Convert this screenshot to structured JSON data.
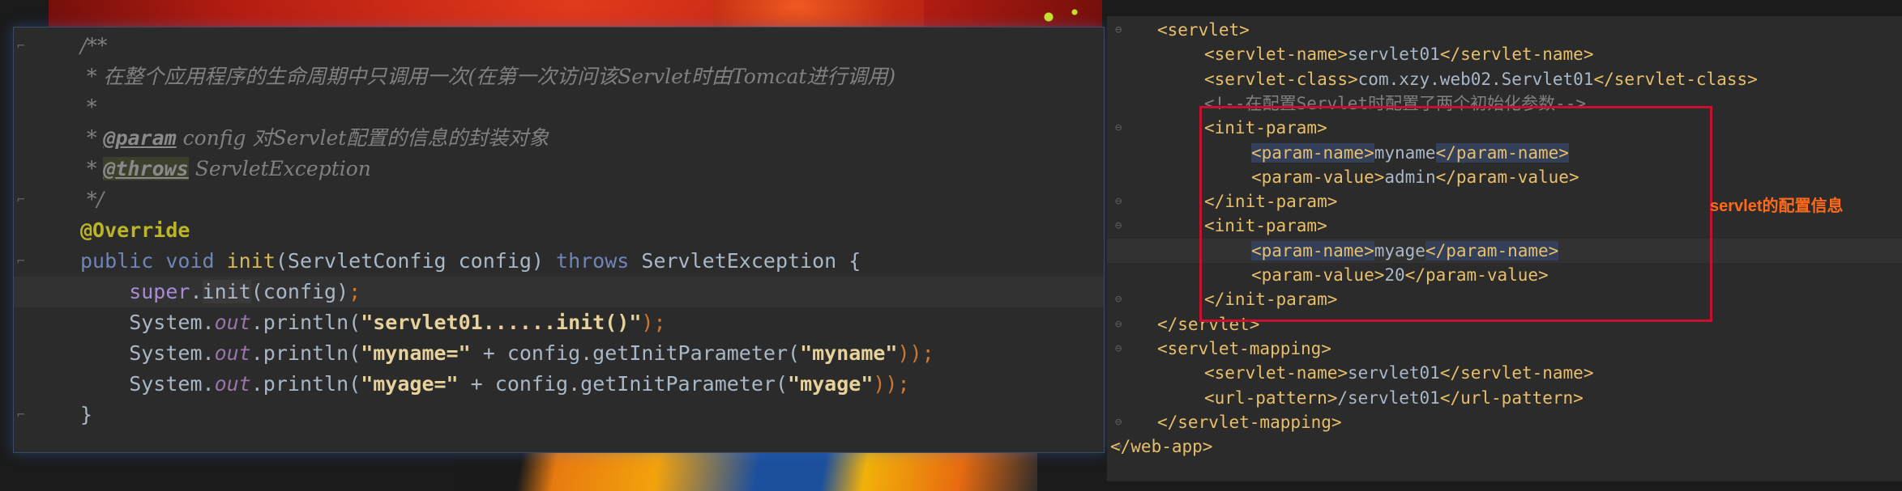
{
  "java_editor": {
    "lines": [
      {
        "parts": [
          {
            "t": "/**",
            "c": "c-comment"
          }
        ]
      },
      {
        "parts": [
          {
            "t": " * 在整个应用程序的生命周期中只调用一次(在第一次访问该Servlet时由Tomcat进行调用)",
            "c": "c-comment"
          }
        ]
      },
      {
        "parts": [
          {
            "t": " *",
            "c": "c-comment"
          }
        ]
      },
      {
        "parts": [
          {
            "t": " * ",
            "c": "c-comment"
          },
          {
            "t": "@param",
            "c": "c-doctag"
          },
          {
            "t": " config",
            "c": "c-comment"
          },
          {
            "t": " 对Servlet配置的信息的封装对象",
            "c": "c-comment"
          }
        ]
      },
      {
        "parts": [
          {
            "t": " * ",
            "c": "c-comment"
          },
          {
            "t": "@throws",
            "c": "c-doctag-warn"
          },
          {
            "t": " ServletException",
            "c": "c-comment"
          }
        ]
      },
      {
        "parts": [
          {
            "t": " */",
            "c": "c-comment"
          }
        ]
      },
      {
        "parts": [
          {
            "t": "@Override",
            "c": "c-anno"
          }
        ]
      },
      {
        "parts": [
          {
            "t": "public void ",
            "c": "c-kw2"
          },
          {
            "t": "init",
            "c": "c-fn"
          },
          {
            "t": "(ServletConfig config) ",
            "c": "c-plain"
          },
          {
            "t": "throws",
            "c": "c-kw2"
          },
          {
            "t": " ServletException {",
            "c": "c-plain"
          }
        ]
      },
      {
        "parts": [
          {
            "t": "    super",
            "c": "c-super"
          },
          {
            "t": ".",
            "c": "c-plain"
          },
          {
            "t": "init",
            "c": "c-init"
          },
          {
            "t": "(config)",
            "c": "c-plain"
          },
          {
            "t": ";",
            "c": "c-kw"
          }
        ]
      },
      {
        "parts": [
          {
            "t": "    System.",
            "c": "c-plain"
          },
          {
            "t": "out",
            "c": "c-field"
          },
          {
            "t": ".println(",
            "c": "c-plain"
          },
          {
            "t": "\"servlet01......init()\"",
            "c": "c-strb"
          },
          {
            "t": ");",
            "c": "c-kw"
          }
        ]
      },
      {
        "parts": [
          {
            "t": "    System.",
            "c": "c-plain"
          },
          {
            "t": "out",
            "c": "c-field"
          },
          {
            "t": ".println(",
            "c": "c-plain"
          },
          {
            "t": "\"myname=\"",
            "c": "c-strb"
          },
          {
            "t": " + config.getInitParameter(",
            "c": "c-plain"
          },
          {
            "t": "\"myname\"",
            "c": "c-strb"
          },
          {
            "t": "));",
            "c": "c-kw"
          }
        ]
      },
      {
        "parts": [
          {
            "t": "    System.",
            "c": "c-plain"
          },
          {
            "t": "out",
            "c": "c-field"
          },
          {
            "t": ".println(",
            "c": "c-plain"
          },
          {
            "t": "\"myage=\"",
            "c": "c-strb"
          },
          {
            "t": " + config.getInitParameter(",
            "c": "c-plain"
          },
          {
            "t": "\"myage\"",
            "c": "c-strb"
          },
          {
            "t": "));",
            "c": "c-kw"
          }
        ]
      },
      {
        "parts": [
          {
            "t": "}",
            "c": "c-plain"
          }
        ]
      }
    ]
  },
  "xml_editor": {
    "lines": [
      {
        "indent": 2,
        "parts": [
          {
            "t": "<servlet>",
            "c": "x-tag"
          }
        ]
      },
      {
        "indent": 4,
        "parts": [
          {
            "t": "<servlet-name>",
            "c": "x-tag"
          },
          {
            "t": "servlet01",
            "c": "x-text"
          },
          {
            "t": "</servlet-name>",
            "c": "x-tag"
          }
        ]
      },
      {
        "indent": 4,
        "parts": [
          {
            "t": "<servlet-class>",
            "c": "x-tag"
          },
          {
            "t": "com.xzy.web02.Servlet01",
            "c": "x-text"
          },
          {
            "t": "</servlet-class>",
            "c": "x-tag"
          }
        ]
      },
      {
        "indent": 4,
        "parts": [
          {
            "t": "<!--在配置Servlet时配置了两个初始化参数-->",
            "c": "x-comment"
          }
        ]
      },
      {
        "indent": 4,
        "parts": [
          {
            "t": "<init-param>",
            "c": "x-tag"
          }
        ]
      },
      {
        "indent": 6,
        "parts": [
          {
            "t": "<param-name>",
            "c": "x-hltag"
          },
          {
            "t": "myname",
            "c": "x-text"
          },
          {
            "t": "</param-name>",
            "c": "x-hltag"
          }
        ]
      },
      {
        "indent": 6,
        "parts": [
          {
            "t": "<param-value>",
            "c": "x-tag"
          },
          {
            "t": "admin",
            "c": "x-text"
          },
          {
            "t": "</param-value>",
            "c": "x-tag"
          }
        ]
      },
      {
        "indent": 4,
        "parts": [
          {
            "t": "</init-param>",
            "c": "x-tag"
          }
        ]
      },
      {
        "indent": 4,
        "parts": [
          {
            "t": "<init-param>",
            "c": "x-tag"
          }
        ]
      },
      {
        "indent": 6,
        "parts": [
          {
            "t": "<param-name>",
            "c": "x-hltag"
          },
          {
            "t": "myage",
            "c": "x-text"
          },
          {
            "t": "</param-name>",
            "c": "x-hltag"
          }
        ]
      },
      {
        "indent": 6,
        "parts": [
          {
            "t": "<param-value>",
            "c": "x-tag"
          },
          {
            "t": "20",
            "c": "x-text"
          },
          {
            "t": "</param-value>",
            "c": "x-tag"
          }
        ]
      },
      {
        "indent": 4,
        "parts": [
          {
            "t": "</init-param>",
            "c": "x-tag"
          }
        ]
      },
      {
        "indent": 2,
        "parts": [
          {
            "t": "</servlet>",
            "c": "x-tag"
          }
        ]
      },
      {
        "indent": 2,
        "parts": [
          {
            "t": "<servlet-mapping>",
            "c": "x-tag"
          }
        ]
      },
      {
        "indent": 4,
        "parts": [
          {
            "t": "<servlet-name>",
            "c": "x-tag"
          },
          {
            "t": "servlet01",
            "c": "x-text"
          },
          {
            "t": "</servlet-name>",
            "c": "x-tag"
          }
        ]
      },
      {
        "indent": 4,
        "parts": [
          {
            "t": "<url-pattern>",
            "c": "x-tag"
          },
          {
            "t": "/servlet01",
            "c": "x-text"
          },
          {
            "t": "</url-pattern>",
            "c": "x-tag"
          }
        ]
      },
      {
        "indent": 2,
        "parts": [
          {
            "t": "</servlet-mapping>",
            "c": "x-tag"
          }
        ]
      },
      {
        "indent": 0,
        "parts": [
          {
            "t": "</web-app>",
            "c": "x-tag"
          }
        ]
      }
    ]
  },
  "annotation": {
    "label": "servlet的配置信息",
    "color": "#ff6a1a",
    "box_color": "#c8102e"
  }
}
